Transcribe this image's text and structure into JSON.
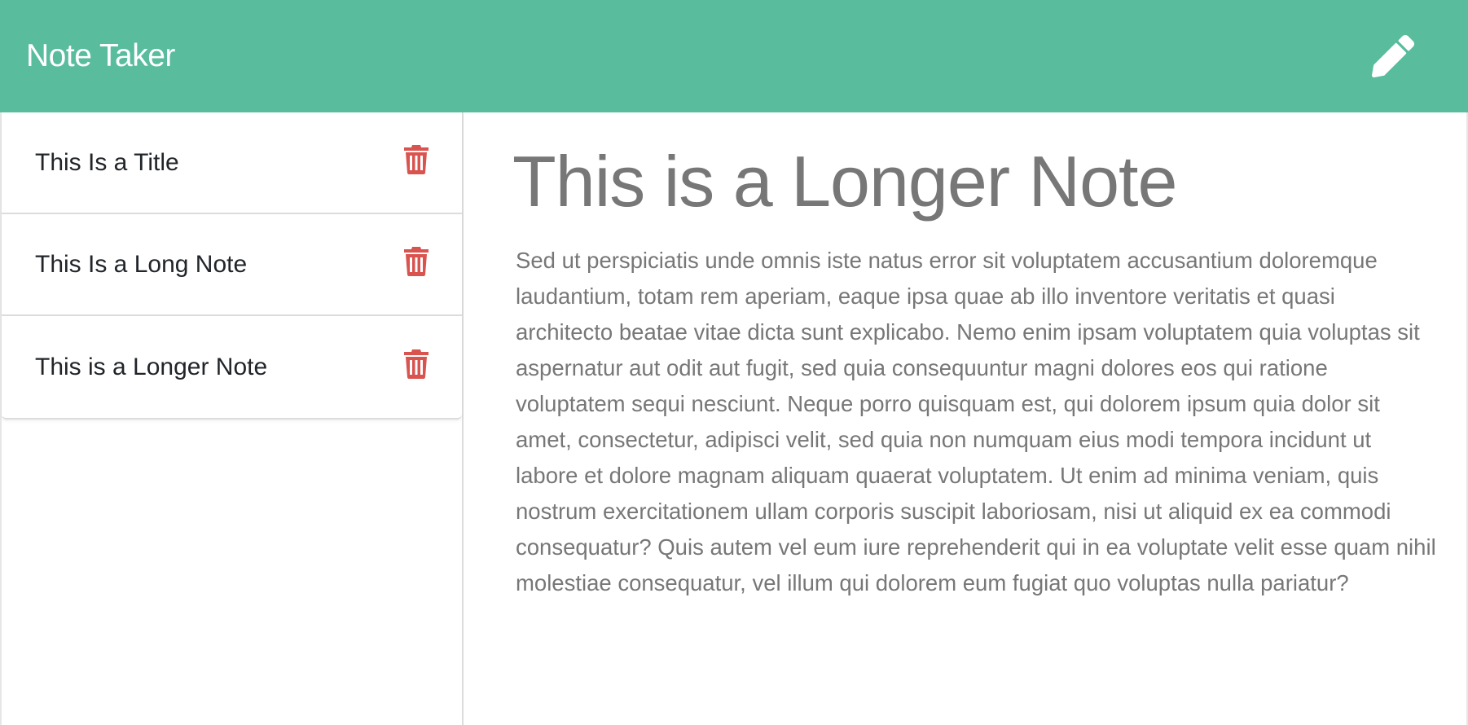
{
  "navbar": {
    "brand": "Note Taker",
    "new_note_icon": "pencil-icon",
    "color": "#58bc9d"
  },
  "sidebar": {
    "delete_icon": "trash-icon",
    "delete_color": "#d9534f",
    "notes": [
      {
        "title": "This Is a Title"
      },
      {
        "title": "This Is a Long Note"
      },
      {
        "title": "This is a Longer Note"
      }
    ]
  },
  "active_note": {
    "title": "This is a Longer Note",
    "body": "Sed ut perspiciatis unde omnis iste natus error sit voluptatem accusantium doloremque laudantium, totam rem aperiam, eaque ipsa quae ab illo inventore veritatis et quasi architecto beatae vitae dicta sunt explicabo. Nemo enim ipsam voluptatem quia voluptas sit aspernatur aut odit aut fugit, sed quia consequuntur magni dolores eos qui ratione voluptatem sequi nesciunt. Neque porro quisquam est, qui dolorem ipsum quia dolor sit amet, consectetur, adipisci velit, sed quia non numquam eius modi tempora incidunt ut labore et dolore magnam aliquam quaerat voluptatem. Ut enim ad minima veniam, quis nostrum exercitationem ullam corporis suscipit laboriosam, nisi ut aliquid ex ea commodi consequatur? Quis autem vel eum iure reprehenderit qui in ea voluptate velit esse quam nihil molestiae consequatur, vel illum qui dolorem eum fugiat quo voluptas nulla pariatur?"
  }
}
